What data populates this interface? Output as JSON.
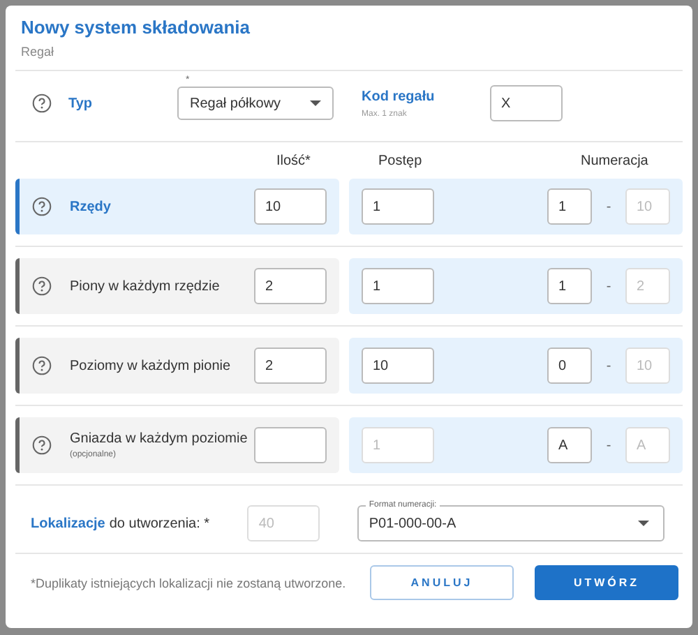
{
  "dialog": {
    "title": "Nowy system składowania",
    "subtitle": "Regał"
  },
  "type_row": {
    "label": "Typ",
    "select_required_mark": "*",
    "select_value": "Regał półkowy",
    "code_label": "Kod regału",
    "code_hint": "Max. 1 znak",
    "code_value": "X"
  },
  "columns": [
    "Ilość*",
    "Postęp",
    "Numeracja"
  ],
  "rows": [
    {
      "label": "Rzędy",
      "note": "",
      "selected": true,
      "quantity": "10",
      "progress": "1",
      "progress_disabled": false,
      "number_from": "1",
      "separator": "-",
      "number_to": "10"
    },
    {
      "label": "Piony w każdym rzędzie",
      "note": "",
      "selected": false,
      "quantity": "2",
      "progress": "1",
      "progress_disabled": false,
      "number_from": "1",
      "separator": "-",
      "number_to": "2"
    },
    {
      "label": "Poziomy w każdym pionie",
      "note": "",
      "selected": false,
      "quantity": "2",
      "progress": "10",
      "progress_disabled": false,
      "number_from": "0",
      "separator": "-",
      "number_to": "10"
    },
    {
      "label": "Gniazda w każdym poziomie",
      "note": "(opcjonalne)",
      "selected": false,
      "quantity": "",
      "progress": "1",
      "progress_disabled": true,
      "number_from": "A",
      "separator": "-",
      "number_to": "A"
    }
  ],
  "locations": {
    "highlight": "Lokalizacje",
    "rest": "do utworzenia: *",
    "value": "40",
    "format_label": "Format numeracji:",
    "format_value": "P01-000-00-A"
  },
  "footer": {
    "note": "*Duplikaty istniejących lokalizacji nie zostaną utworzone.",
    "buttons": [
      {
        "label": "ANULUJ",
        "kind": "secondary"
      },
      {
        "label": "UTWÓRZ",
        "kind": "primary"
      }
    ]
  }
}
